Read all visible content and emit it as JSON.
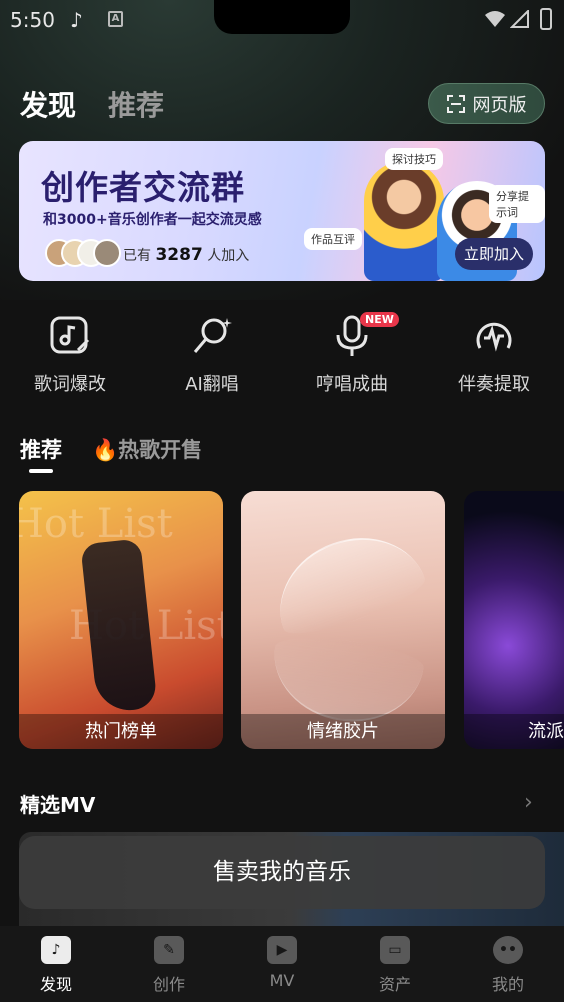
{
  "status_bar": {
    "time": "5:50"
  },
  "header": {
    "tab_active": "发现",
    "tab_inactive": "推荐",
    "web_button": "网页版"
  },
  "banner": {
    "title": "创作者交流群",
    "subtitle": "和3000+音乐创作者一起交流灵感",
    "joined_prefix": "已有",
    "joined_count": "3287",
    "joined_suffix": "人加入",
    "join_button": "立即加入",
    "bubble_1": "探讨技巧",
    "bubble_2": "分享提示词",
    "bubble_3": "作品互评"
  },
  "quick_actions": [
    {
      "label": "歌词爆改",
      "icon": "lyrics-edit-icon"
    },
    {
      "label": "AI翻唱",
      "icon": "ai-cover-icon"
    },
    {
      "label": "哼唱成曲",
      "icon": "microphone-icon",
      "badge": "NEW"
    },
    {
      "label": "伴奏提取",
      "icon": "accompaniment-icon"
    }
  ],
  "content_tabs": {
    "active": "推荐",
    "inactive": "热歌开售",
    "inactive_emoji": "🔥"
  },
  "cards": [
    {
      "caption": "热门榜单",
      "watermark": "Hot List"
    },
    {
      "caption": "情绪胶片"
    },
    {
      "caption": "流派"
    }
  ],
  "mv_section": {
    "title": "精选MV",
    "sell_button": "售卖我的音乐"
  },
  "bottom_nav": [
    {
      "label": "发现",
      "icon": "discover-icon",
      "active": true
    },
    {
      "label": "创作",
      "icon": "create-icon",
      "active": false
    },
    {
      "label": "MV",
      "icon": "mv-icon",
      "active": false
    },
    {
      "label": "资产",
      "icon": "assets-icon",
      "active": false
    },
    {
      "label": "我的",
      "icon": "profile-icon",
      "active": false
    }
  ],
  "colors": {
    "background": "#121212",
    "accent_green": "#3b5a4a",
    "badge_red": "#e8364a"
  }
}
